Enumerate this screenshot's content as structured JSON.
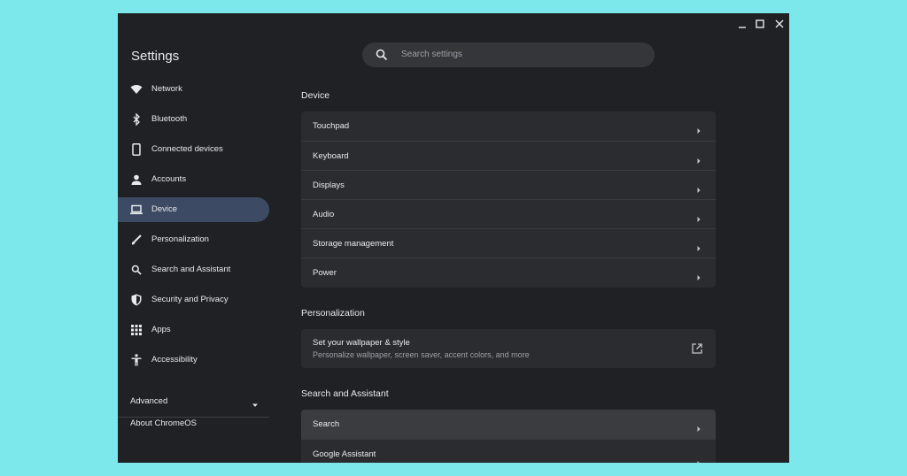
{
  "window": {
    "controls": {
      "minimize_icon": "minimize-icon",
      "maximize_icon": "maximize-icon",
      "close_icon": "close-icon"
    }
  },
  "header": {
    "title": "Settings",
    "search": {
      "placeholder": "Search settings",
      "icon": "search-icon"
    }
  },
  "sidebar": {
    "items": [
      {
        "label": "Network",
        "icon": "wifi-icon",
        "active": false
      },
      {
        "label": "Bluetooth",
        "icon": "bluetooth-icon",
        "active": false
      },
      {
        "label": "Connected devices",
        "icon": "phone-icon",
        "active": false
      },
      {
        "label": "Accounts",
        "icon": "person-icon",
        "active": false
      },
      {
        "label": "Device",
        "icon": "laptop-icon",
        "active": true
      },
      {
        "label": "Personalization",
        "icon": "brush-icon",
        "active": false
      },
      {
        "label": "Search and Assistant",
        "icon": "search-icon",
        "active": false
      },
      {
        "label": "Security and Privacy",
        "icon": "shield-icon",
        "active": false
      },
      {
        "label": "Apps",
        "icon": "apps-grid-icon",
        "active": false
      },
      {
        "label": "Accessibility",
        "icon": "accessibility-icon",
        "active": false
      }
    ],
    "advanced": {
      "label": "Advanced",
      "icon": "caret-down-icon"
    },
    "about": {
      "label": "About ChromeOS"
    }
  },
  "main": {
    "device": {
      "title": "Device",
      "rows": [
        {
          "label": "Touchpad"
        },
        {
          "label": "Keyboard"
        },
        {
          "label": "Displays"
        },
        {
          "label": "Audio"
        },
        {
          "label": "Storage management"
        },
        {
          "label": "Power"
        }
      ]
    },
    "personalization": {
      "title": "Personalization",
      "wallpaper": {
        "title": "Set your wallpaper & style",
        "subtitle": "Personalize wallpaper, screen saver, accent colors, and more",
        "icon": "open-in-new-icon"
      }
    },
    "search_assistant": {
      "title": "Search and Assistant",
      "rows": [
        {
          "label": "Search",
          "highlighted": true
        },
        {
          "label": "Google Assistant",
          "highlighted": false
        }
      ]
    }
  },
  "colors": {
    "background": "#7de8ec",
    "window": "#202124",
    "card": "#2b2c30",
    "active_nav": "#3c4a63",
    "text": "#e8eaed",
    "secondary_text": "#9aa0a6"
  }
}
